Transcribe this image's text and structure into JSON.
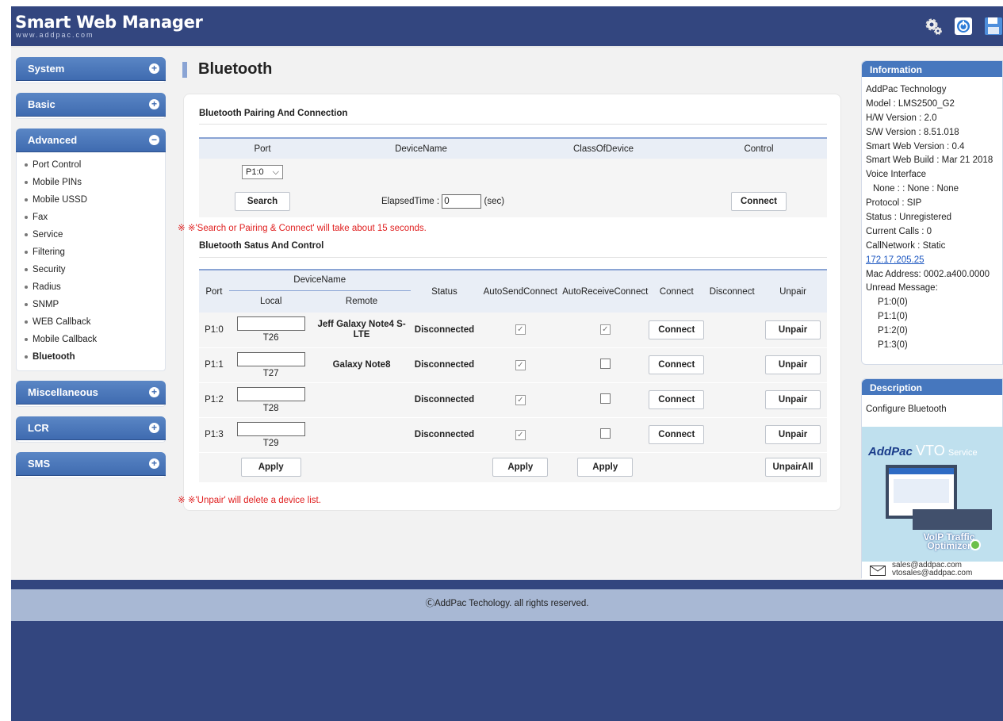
{
  "app": {
    "title": "Smart Web Manager",
    "subtitle": "www.addpac.com"
  },
  "top_icons": [
    "gear-icon",
    "power-icon",
    "save-icon"
  ],
  "menu": [
    {
      "label": "System",
      "expanded": false,
      "items": []
    },
    {
      "label": "Basic",
      "expanded": false,
      "items": []
    },
    {
      "label": "Advanced",
      "expanded": true,
      "items": [
        "Port Control",
        "Mobile PINs",
        "Mobile USSD",
        "Fax",
        "Service",
        "Filtering",
        "Security",
        "Radius",
        "SNMP",
        "WEB Callback",
        "Mobile Callback",
        "Bluetooth"
      ]
    },
    {
      "label": "Miscellaneous",
      "expanded": false,
      "items": []
    },
    {
      "label": "LCR",
      "expanded": false,
      "items": []
    },
    {
      "label": "SMS",
      "expanded": false,
      "items": []
    }
  ],
  "page": {
    "title": "Bluetooth",
    "pairing": {
      "section_title": "Bluetooth Pairing And Connection",
      "headers": [
        "Port",
        "DeviceName",
        "ClassOfDevice",
        "Control"
      ],
      "port_select": "P1:0",
      "search_label": "Search",
      "elapsed_label": "ElapsedTime :",
      "elapsed_value": "0",
      "elapsed_unit": "(sec)",
      "connect_label": "Connect",
      "note": "※ ※'Search or Pairing & Connect' will take about 15 seconds."
    },
    "status": {
      "section_title": "Bluetooth Satus And Control",
      "headers": {
        "port": "Port",
        "device_name": "DeviceName",
        "local": "Local",
        "remote": "Remote",
        "status": "Status",
        "auto_send": "AutoSendConnect",
        "auto_receive": "AutoReceiveConnect",
        "connect": "Connect",
        "disconnect": "Disconnect",
        "unpair": "Unpair"
      },
      "rows": [
        {
          "port": "P1:0",
          "local": "T26",
          "remote": "Jeff Galaxy Note4 S-LTE",
          "status": "Disconnected",
          "auto_send": true,
          "auto_receive": true
        },
        {
          "port": "P1:1",
          "local": "T27",
          "remote": "Galaxy Note8",
          "status": "Disconnected",
          "auto_send": true,
          "auto_receive": false
        },
        {
          "port": "P1:2",
          "local": "T28",
          "remote": "",
          "status": "Disconnected",
          "auto_send": true,
          "auto_receive": false
        },
        {
          "port": "P1:3",
          "local": "T29",
          "remote": "",
          "status": "Disconnected",
          "auto_send": true,
          "auto_receive": false
        }
      ],
      "row_connect_label": "Connect",
      "row_unpair_label": "Unpair",
      "apply_label": "Apply",
      "unpair_all_label": "UnpairAll",
      "note": "※ ※'Unpair' will delete a device list."
    }
  },
  "information": {
    "title": "Information",
    "lines": [
      "AddPac Technology",
      "Model : LMS2500_G2",
      "H/W Version : 2.0",
      "S/W Version : 8.51.018",
      "Smart Web Version : 0.4",
      "Smart Web Build : Mar 21 2018",
      "Voice Interface",
      "None : : None : None",
      "Protocol : SIP",
      "Status : Unregistered",
      "Current Calls : 0",
      "CallNetwork : Static",
      "172.17.205.25",
      "Mac Address: 0002.a400.0000",
      "Unread Message:",
      "P1:0(0)",
      "P1:1(0)",
      "P1:2(0)",
      "P1:3(0)"
    ]
  },
  "description": {
    "title": "Description",
    "text": "Configure Bluetooth",
    "ad": {
      "brand": "AddPac",
      "product": "VTO",
      "service": "Service",
      "tagline": "VoIP Traffic Optimizer",
      "email1": "sales@addpac.com",
      "email2": "vtosales@addpac.com"
    }
  },
  "footer": {
    "text": "ⒸAddPac Techology. all rights reserved."
  },
  "colors": {
    "header_bg": "#33467f",
    "menu_head": "#4677be",
    "note_red": "#e02020",
    "footer_bg": "#a8b8d4"
  }
}
